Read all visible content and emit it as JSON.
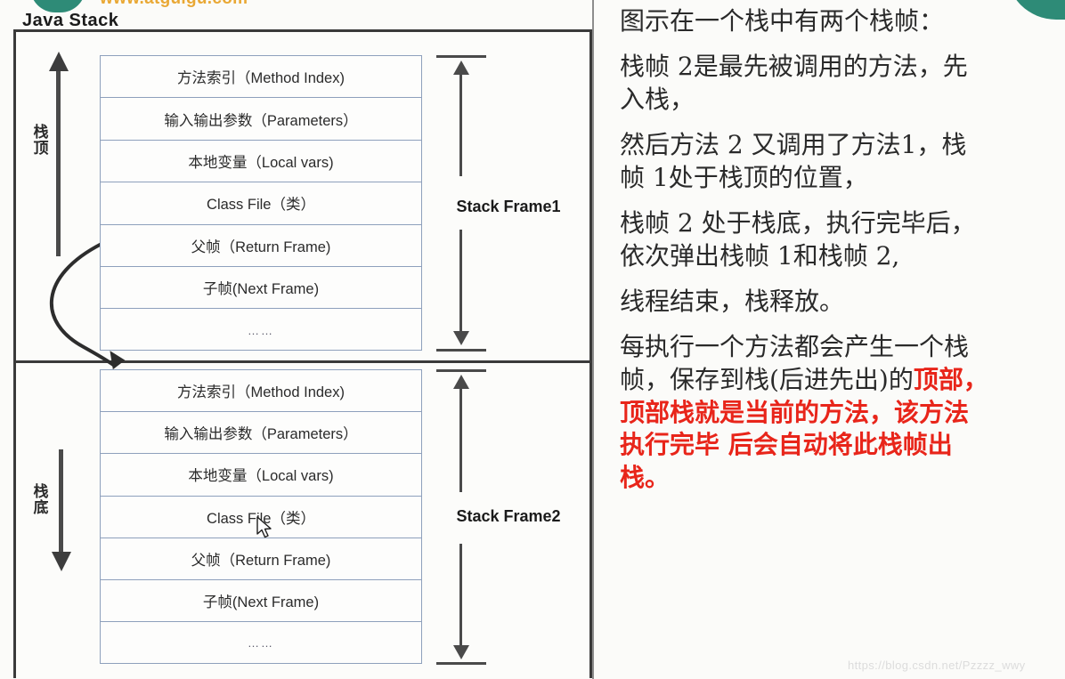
{
  "branding": {
    "site_url": "www.atguigu.com",
    "logo": "atguigu-logo"
  },
  "diagram": {
    "title": "Java Stack",
    "side_labels": {
      "top": "栈顶",
      "bottom": "栈底"
    },
    "frames": [
      {
        "dimension_label": "Stack Frame1",
        "rows": [
          "方法索引（Method Index)",
          "输入输出参数（Parameters）",
          "本地变量（Local vars)",
          "Class File（类）",
          "父帧（Return Frame)",
          "子帧(Next Frame)",
          "……"
        ]
      },
      {
        "dimension_label": "Stack Frame2",
        "rows": [
          "方法索引（Method Index)",
          "输入输出参数（Parameters）",
          "本地变量（Local vars)",
          "Class File（类）",
          "父帧（Return Frame)",
          "子帧(Next Frame)",
          "……"
        ]
      }
    ]
  },
  "notes": {
    "p1": "图示在一个栈中有两个栈帧：",
    "p2_line1": "栈帧 2是最先被调用的方法，先",
    "p2_line2": "入栈，",
    "p3_line1": "然后方法 2 又调用了方法1，栈",
    "p3_line2": "帧 1处于栈顶的位置，",
    "p4_line1": "栈帧 2 处于栈底，执行完毕后，",
    "p4_line2": "依次弹出栈帧 1和栈帧 2,",
    "p5": "线程结束，栈释放。",
    "p6_line1": "每执行一个方法都会产生一个栈",
    "p6_line2_black": "帧，保存到栈(后进先出)的",
    "p6_line2_red": "顶部，",
    "p6_line3_red": "顶部栈就是当前的方法，该方法",
    "p6_line4_red": "执行完毕 后会自动将此栈帧出",
    "p6_line5_red": "栈。"
  },
  "watermark": {
    "text": "https://blog.csdn.net/Pzzzz_wwy"
  },
  "colors": {
    "accent_red": "#e8251a",
    "logo_teal": "#2e8b77",
    "logo_orange": "#e8a020",
    "row_border": "#8ea0bc",
    "outer_border": "#3a3a3a"
  }
}
